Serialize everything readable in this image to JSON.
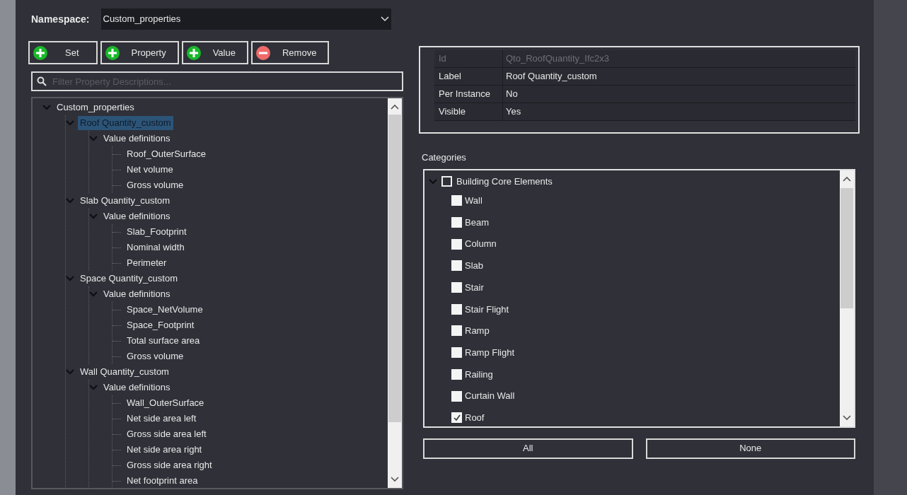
{
  "namespace": {
    "label": "Namespace:",
    "value": "Custom_properties"
  },
  "toolbar": [
    {
      "label": "Set",
      "kind": "add"
    },
    {
      "label": "Property",
      "kind": "add"
    },
    {
      "label": "Value",
      "kind": "add"
    },
    {
      "label": "Remove",
      "kind": "remove"
    }
  ],
  "filter": {
    "placeholder": "Filter Property Descriptions..."
  },
  "tree": [
    {
      "label": "Custom_properties",
      "selected": false,
      "expanded": true,
      "children": [
        {
          "label": "Roof Quantity_custom",
          "selected": true,
          "expanded": true,
          "children": [
            {
              "label": "Value definitions",
              "selected": false,
              "expanded": true,
              "children": [
                {
                  "label": "Roof_OuterSurface",
                  "selected": false
                },
                {
                  "label": "Net volume",
                  "selected": false
                },
                {
                  "label": "Gross volume",
                  "selected": false
                }
              ]
            }
          ]
        },
        {
          "label": "Slab Quantity_custom",
          "selected": false,
          "expanded": true,
          "children": [
            {
              "label": "Value definitions",
              "selected": false,
              "expanded": true,
              "children": [
                {
                  "label": "Slab_Footprint",
                  "selected": false
                },
                {
                  "label": "Nominal width",
                  "selected": false
                },
                {
                  "label": "Perimeter",
                  "selected": false
                }
              ]
            }
          ]
        },
        {
          "label": "Space Quantity_custom",
          "selected": false,
          "expanded": true,
          "children": [
            {
              "label": "Value definitions",
              "selected": false,
              "expanded": true,
              "children": [
                {
                  "label": "Space_NetVolume",
                  "selected": false
                },
                {
                  "label": "Space_Footprint",
                  "selected": false
                },
                {
                  "label": "Total surface area",
                  "selected": false
                },
                {
                  "label": "Gross volume",
                  "selected": false
                }
              ]
            }
          ]
        },
        {
          "label": "Wall Quantity_custom",
          "selected": false,
          "expanded": true,
          "children": [
            {
              "label": "Value definitions",
              "selected": false,
              "expanded": true,
              "children": [
                {
                  "label": "Wall_OuterSurface",
                  "selected": false
                },
                {
                  "label": "Net side area left",
                  "selected": false
                },
                {
                  "label": "Gross side area left",
                  "selected": false
                },
                {
                  "label": "Net side area right",
                  "selected": false
                },
                {
                  "label": "Gross side area right",
                  "selected": false
                },
                {
                  "label": "Net footprint area",
                  "selected": false
                }
              ]
            }
          ]
        }
      ]
    }
  ],
  "properties": [
    {
      "name": "Id",
      "value": "Qto_RoofQuantity_Ifc2x3",
      "disabled": true
    },
    {
      "name": "Label",
      "value": "Roof Quantity_custom",
      "disabled": false
    },
    {
      "name": "Per Instance",
      "value": "No",
      "disabled": false
    },
    {
      "name": "Visible",
      "value": "Yes",
      "disabled": false
    }
  ],
  "categories": {
    "title": "Categories",
    "items": [
      {
        "label": "Building Core Elements",
        "checked": false,
        "expanded": true,
        "children": [
          {
            "label": "Wall",
            "checked": false
          },
          {
            "label": "Beam",
            "checked": false
          },
          {
            "label": "Column",
            "checked": false
          },
          {
            "label": "Slab",
            "checked": false
          },
          {
            "label": "Stair",
            "checked": false
          },
          {
            "label": "Stair Flight",
            "checked": false
          },
          {
            "label": "Ramp",
            "checked": false
          },
          {
            "label": "Ramp Flight",
            "checked": false
          },
          {
            "label": "Railing",
            "checked": false
          },
          {
            "label": "Curtain Wall",
            "checked": false
          },
          {
            "label": "Roof",
            "checked": true
          }
        ]
      }
    ]
  },
  "buttons": [
    "All",
    "None"
  ]
}
